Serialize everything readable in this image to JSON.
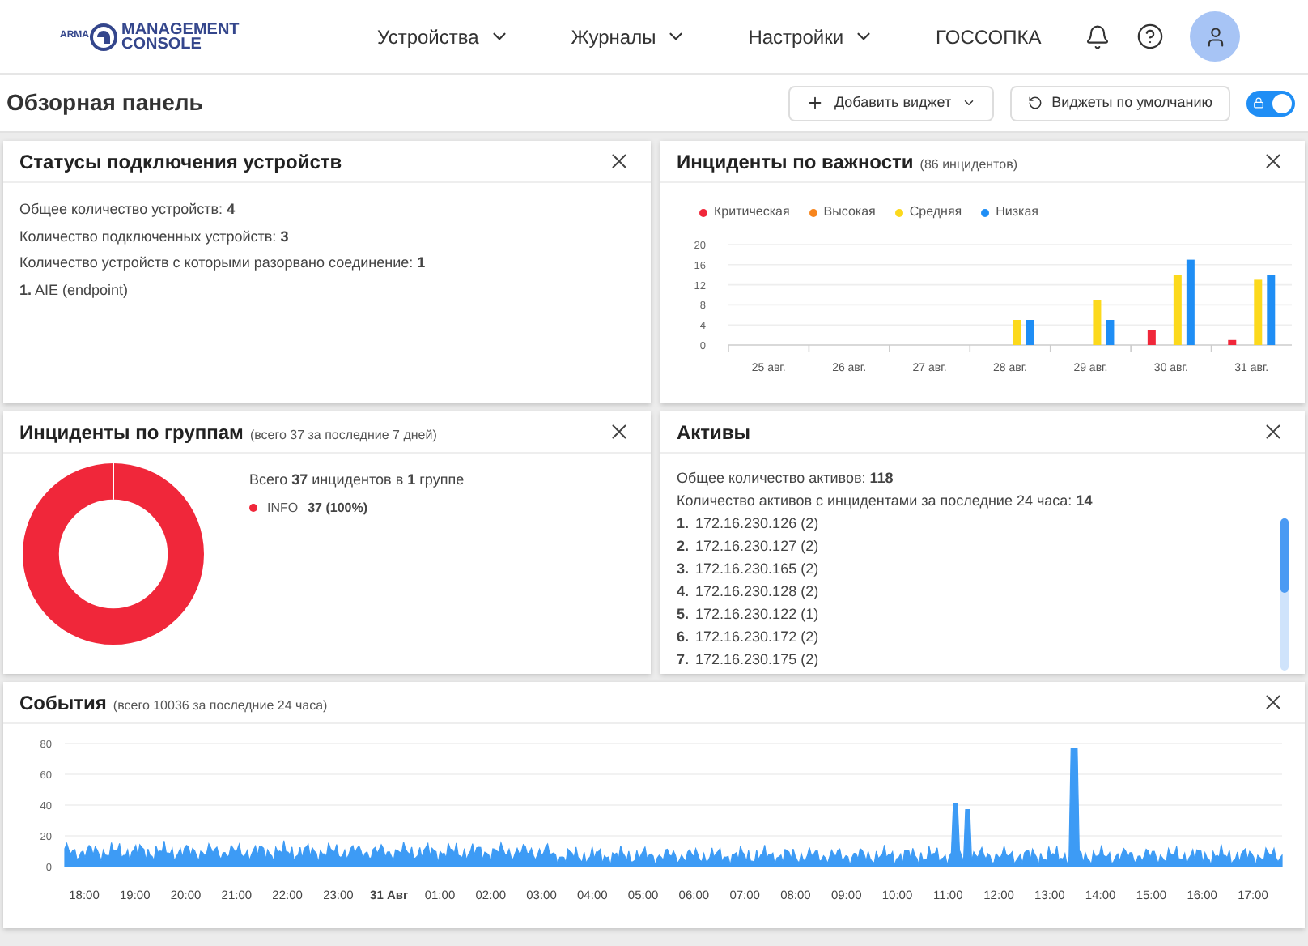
{
  "header": {
    "logo_small": "ARMA",
    "logo_line1": "MANAGEMENT",
    "logo_line2": "CONSOLE",
    "nav": [
      {
        "label": "Устройства",
        "dropdown": true
      },
      {
        "label": "Журналы",
        "dropdown": true
      },
      {
        "label": "Настройки",
        "dropdown": true
      },
      {
        "label": "ГОССОПКА",
        "dropdown": false
      }
    ]
  },
  "toolbar": {
    "title": "Обзорная панель",
    "add_button": "Добавить виджет",
    "default_button": "Виджеты по умолчанию",
    "lock_toggle": {
      "on": true
    }
  },
  "devices_widget": {
    "title": "Статусы подключения устройств",
    "lines": [
      "Общее количество устройств: **4**",
      "Количество подключенных устройств: **3**",
      "Количество устройств с которыми разорвано соединение: **1**",
      "**1.** AIE (endpoint)"
    ]
  },
  "severity_widget": {
    "title": "Инциденты по важности",
    "subtitle": "(86 инцидентов)",
    "chart_data": {
      "type": "bar",
      "grid": true,
      "legend": true,
      "categories": [
        "25 авг.",
        "26 авг.",
        "27 авг.",
        "28 авг.",
        "29 авг.",
        "30 авг.",
        "31 авг."
      ],
      "yticks": [
        0,
        4,
        8,
        12,
        16,
        20
      ],
      "ylim": [
        0,
        20
      ],
      "series": [
        {
          "name": "Критическая",
          "color": "#f0273a",
          "values": [
            0,
            0,
            0,
            0,
            0,
            3,
            1
          ]
        },
        {
          "name": "Высокая",
          "color": "#f7851d",
          "values": [
            0,
            0,
            0,
            0,
            0,
            0,
            0
          ]
        },
        {
          "name": "Средняя",
          "color": "#fcd91c",
          "values": [
            0,
            0,
            0,
            5,
            9,
            14,
            13
          ]
        },
        {
          "name": "Низкая",
          "color": "#1f8ef5",
          "values": [
            0,
            0,
            0,
            5,
            5,
            17,
            14
          ]
        }
      ]
    }
  },
  "groups_widget": {
    "title": "Инциденты по группам",
    "subtitle": "(всего 37 за последние 7 дней)",
    "summary": "Всего **37** инцидентов в **1** группе",
    "legend": [
      {
        "label": "INFO",
        "value": "37 (100%)",
        "color": "#f0273a"
      }
    ]
  },
  "assets_widget": {
    "title": "Активы",
    "lines": [
      "Общее количество активов: **118**",
      "Количество активов с инцидентами за последние 24 часа: **14**"
    ],
    "items": [
      {
        "num": "1.",
        "text": "172.16.230.126 (2)"
      },
      {
        "num": "2.",
        "text": "172.16.230.127 (2)"
      },
      {
        "num": "3.",
        "text": "172.16.230.165 (2)"
      },
      {
        "num": "4.",
        "text": "172.16.230.128 (2)"
      },
      {
        "num": "5.",
        "text": "172.16.230.122 (1)"
      },
      {
        "num": "6.",
        "text": "172.16.230.172 (2)"
      },
      {
        "num": "7.",
        "text": "172.16.230.175 (2)"
      }
    ]
  },
  "events_widget": {
    "title": "События",
    "subtitle": "(всего 10036 за последние 24 часа)",
    "y_labels": [
      "80",
      "60",
      "40",
      "20",
      "0"
    ],
    "x_labels": [
      {
        "label": "18:00",
        "bold": false
      },
      {
        "label": "19:00",
        "bold": false
      },
      {
        "label": "20:00",
        "bold": false
      },
      {
        "label": "21:00",
        "bold": false
      },
      {
        "label": "22:00",
        "bold": false
      },
      {
        "label": "23:00",
        "bold": false
      },
      {
        "label": "31 Авг",
        "bold": true
      },
      {
        "label": "01:00",
        "bold": false
      },
      {
        "label": "02:00",
        "bold": false
      },
      {
        "label": "03:00",
        "bold": false
      },
      {
        "label": "04:00",
        "bold": false
      },
      {
        "label": "05:00",
        "bold": false
      },
      {
        "label": "06:00",
        "bold": false
      },
      {
        "label": "07:00",
        "bold": false
      },
      {
        "label": "08:00",
        "bold": false
      },
      {
        "label": "09:00",
        "bold": false
      },
      {
        "label": "10:00",
        "bold": false
      },
      {
        "label": "11:00",
        "bold": false
      },
      {
        "label": "12:00",
        "bold": false
      },
      {
        "label": "13:00",
        "bold": false
      },
      {
        "label": "14:00",
        "bold": false
      },
      {
        "label": "15:00",
        "bold": false
      },
      {
        "label": "16:00",
        "bold": false
      },
      {
        "label": "17:00",
        "bold": false
      }
    ]
  }
}
